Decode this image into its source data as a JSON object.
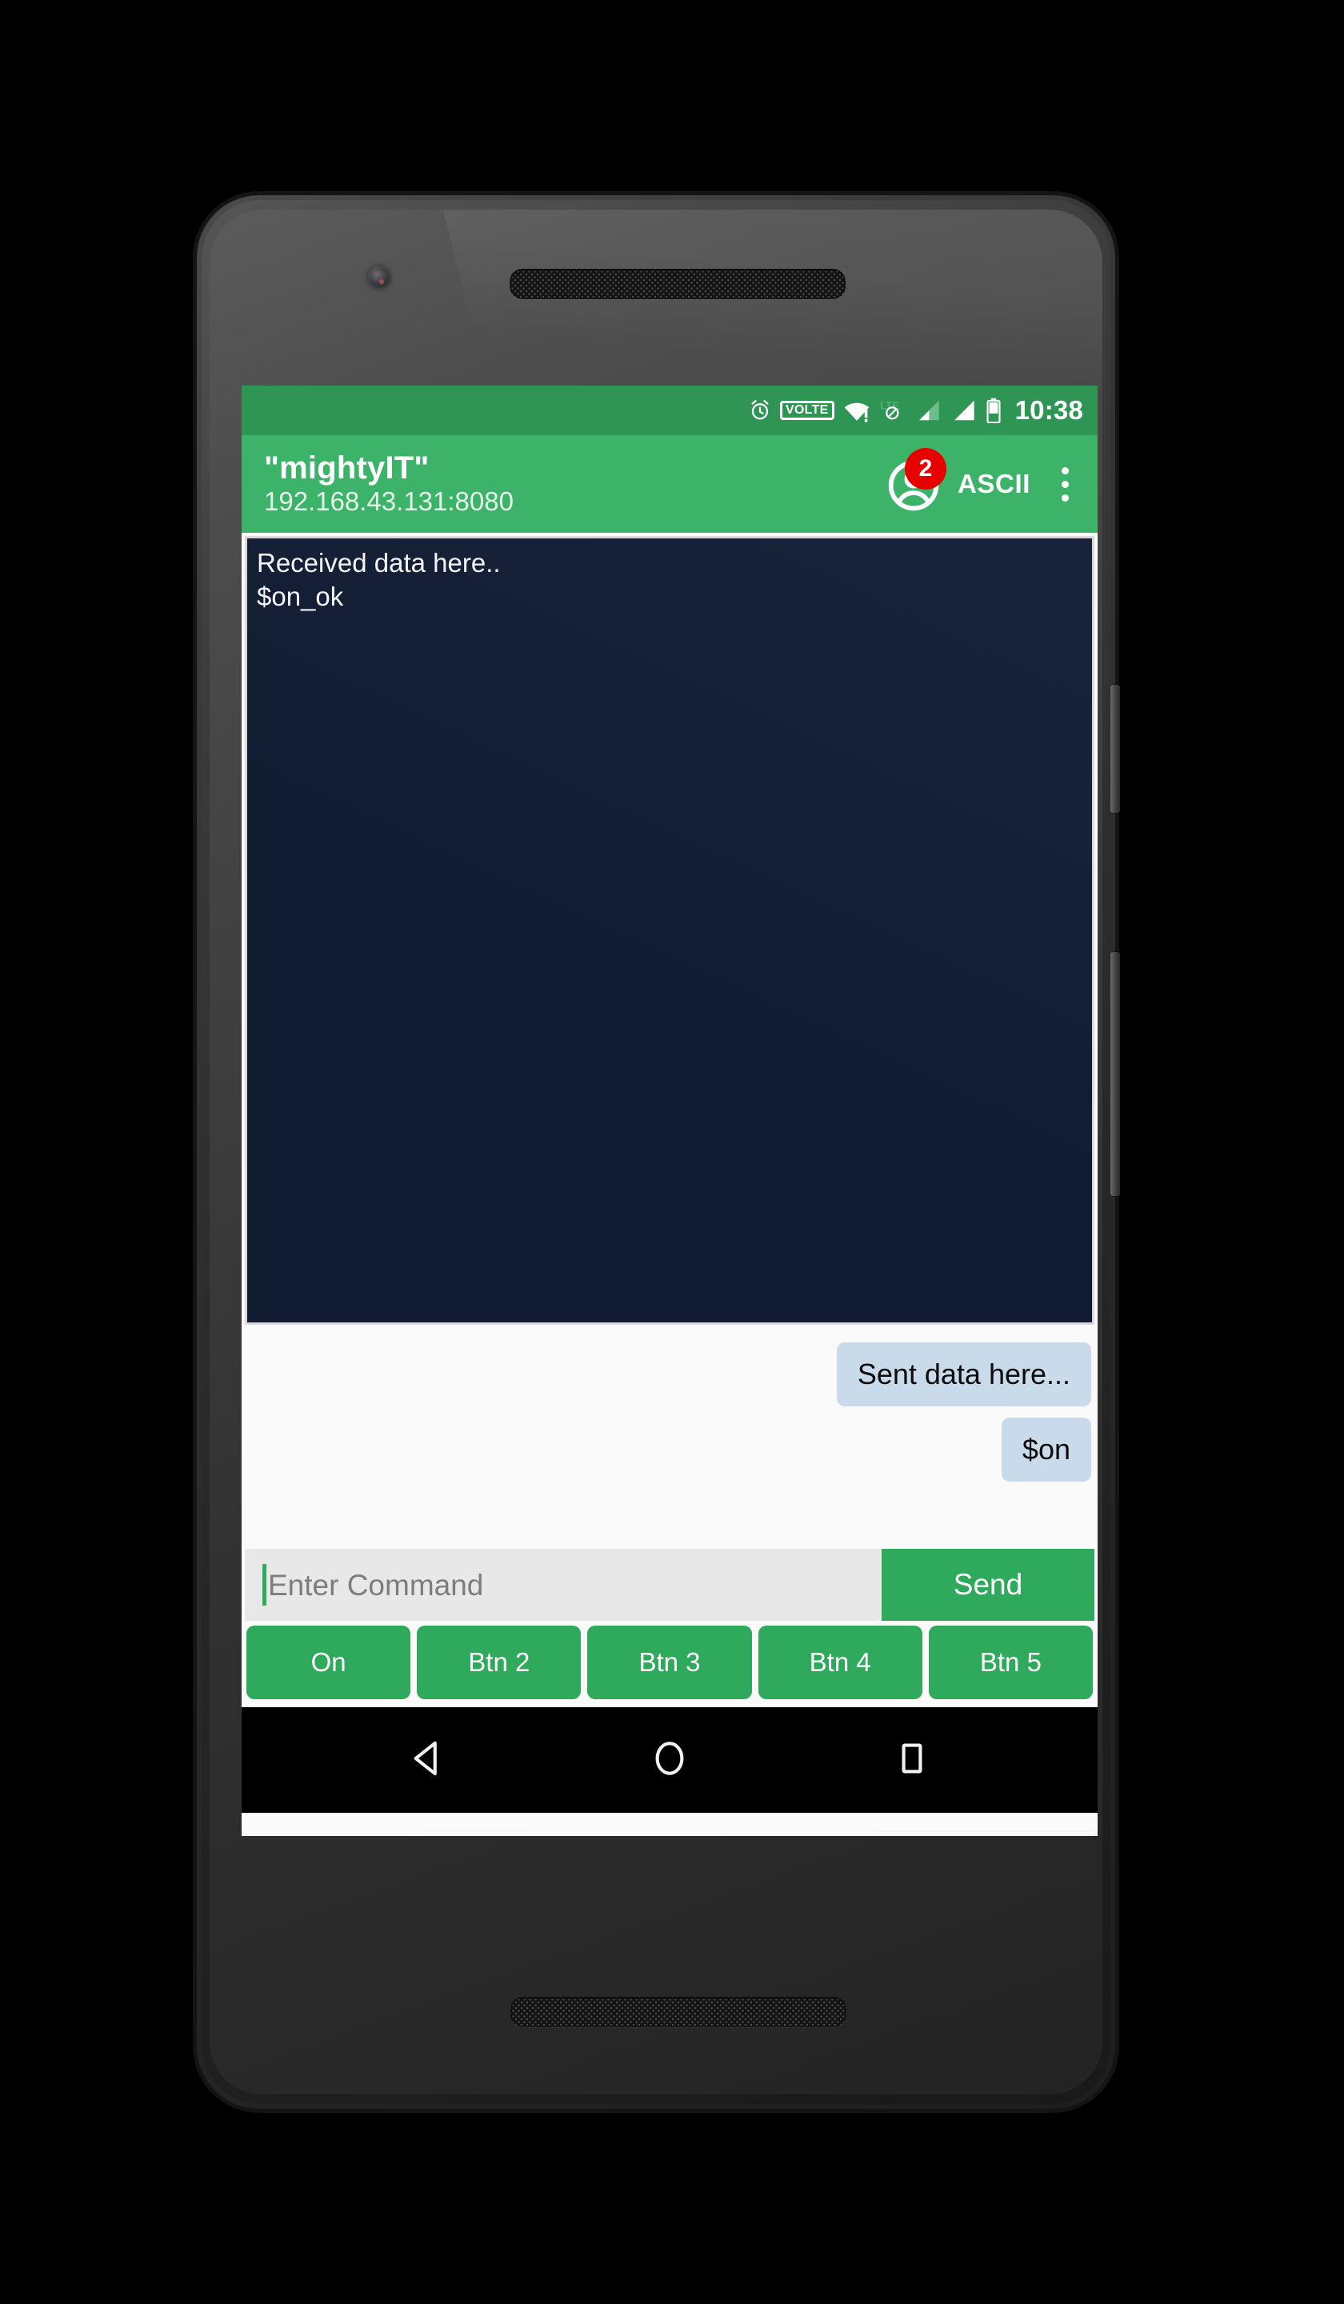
{
  "status_bar": {
    "clock": "10:38",
    "volte_label": "VOLTE",
    "icons": [
      "alarm-icon",
      "volte-icon",
      "wifi-alert-icon",
      "lte-disabled-icon",
      "signal-one-icon",
      "signal-two-icon",
      "battery-icon"
    ],
    "background_color": "#2f9555"
  },
  "app_bar": {
    "title": "\"mightyIT\"",
    "subtitle": "192.168.43.131:8080",
    "account_badge_count": "2",
    "encoding_label": "ASCII",
    "account_icon": "account-circle-icon",
    "overflow_icon": "more-vert-icon",
    "background_color": "#3cb368",
    "badge_color": "#e60000"
  },
  "received": {
    "text": "Received data here..\n$on_ok",
    "background_color": "#111c33",
    "text_color": "#f2f4f8"
  },
  "sent": {
    "bubbles": [
      {
        "text": "Sent data here..."
      },
      {
        "text": "$on"
      }
    ],
    "bubble_color": "#c9daea"
  },
  "input_row": {
    "placeholder": "Enter Command",
    "value": "",
    "send_label": "Send",
    "send_color": "#2fa95c"
  },
  "quick_buttons": [
    {
      "label": "On"
    },
    {
      "label": "Btn 2"
    },
    {
      "label": "Btn 3"
    },
    {
      "label": "Btn 4"
    },
    {
      "label": "Btn 5"
    }
  ],
  "nav_bar": {
    "back": "back-triangle-icon",
    "home": "home-circle-icon",
    "recents": "recents-square-icon"
  }
}
